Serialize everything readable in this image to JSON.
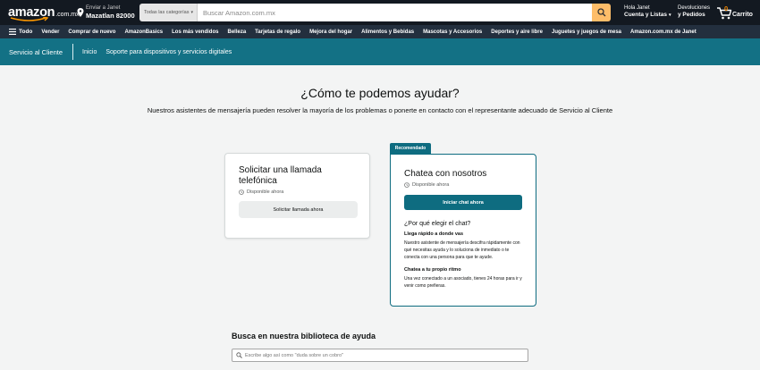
{
  "header": {
    "logo_word": "amazon",
    "logo_tld": ".com.mx",
    "deliver_line1": "Enviar a Janet",
    "deliver_line2": "Mazatlan 82000",
    "search_category": "Todas las categorías",
    "search_placeholder": "Buscar Amazon.com.mx",
    "account_line1": "Hola Janet",
    "account_line2": "Cuenta y Listas",
    "orders_line1": "Devoluciones",
    "orders_line2": "y Pedidos",
    "cart_count": "0",
    "cart_label": "Carrito",
    "accent_color": "#febd69"
  },
  "nav": {
    "all_label": "Todo",
    "items": [
      "Vender",
      "Comprar de nuevo",
      "AmazonBasics",
      "Los más vendidos",
      "Belleza",
      "Tarjetas de regalo",
      "Mejora del hogar",
      "Alimentos y Bebidas",
      "Mascotas y Accesorios",
      "Deportes y aire libre",
      "Juguetes y juegos de mesa",
      "Amazon.com.mx de Janet"
    ]
  },
  "service_bar": {
    "title": "Servicio al Cliente",
    "links": [
      "Inicio",
      "Soporte para dispositivos y servicios digitales"
    ],
    "color": "#137185"
  },
  "main": {
    "headline": "¿Cómo te podemos ayudar?",
    "subhead": "Nuestros asistentes de mensajería pueden resolver la mayoría de los problemas o ponerte en contacto con el representante adecuado de Servicio al Cliente"
  },
  "call_card": {
    "title": "Solicitar una llamada telefónica",
    "availability": "Disponible ahora",
    "button": "Solicitar llamada ahora"
  },
  "chat_card": {
    "badge": "Recomendado",
    "title": "Chatea con nosotros",
    "availability": "Disponible ahora",
    "button": "Iniciar chat ahora",
    "why_title": "¿Por qué elegir el chat?",
    "reason1_title": "Llega rápido a donde vas",
    "reason1_body": "Nuestro asistente de mensajería descifra rápidamente con qué necesitas ayuda y lo soluciona de inmediato o te conecta con una persona para que te ayude.",
    "reason2_title": "Chatea a tu propio ritmo",
    "reason2_body": "Una vez conectado a un asociado, tienes 24 horas para ir y venir como prefieras.",
    "color": "#0e6c80"
  },
  "library": {
    "title": "Busca en nuestra biblioteca de ayuda",
    "placeholder": "Escribe algo así como \"duda sobre un cobro\""
  }
}
